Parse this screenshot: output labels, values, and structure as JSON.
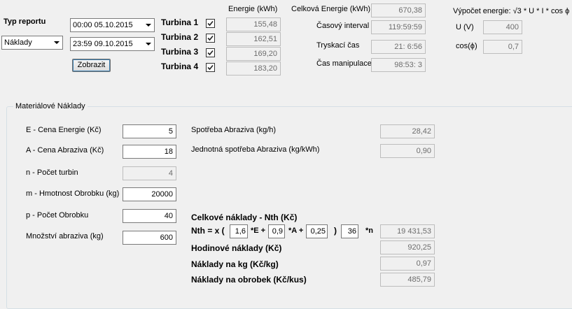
{
  "report": {
    "type_label": "Typ reportu",
    "type_value": "Náklady",
    "date_from": "00:00 05.10.2015",
    "date_to": "23:59 09.10.2015",
    "show_button": "Zobrazit"
  },
  "turbines": {
    "energy_header": "Energie (kWh)",
    "items": [
      {
        "label": "Turbina 1",
        "checked": true,
        "value": "155,48"
      },
      {
        "label": "Turbina 2",
        "checked": true,
        "value": "162,51"
      },
      {
        "label": "Turbina 3",
        "checked": true,
        "value": "169,20"
      },
      {
        "label": "Turbina 4",
        "checked": true,
        "value": "183,20"
      }
    ]
  },
  "summary": {
    "total_energy_label": "Celková Energie (kWh)",
    "total_energy_value": "670,38",
    "time_interval_label": "Časový interval",
    "time_interval_value": "119:59:59",
    "blast_time_label": "Tryskací čas",
    "blast_time_value": "21: 6:56",
    "handling_time_label": "Čas manipulace",
    "handling_time_value": "98:53: 3"
  },
  "energy_calc": {
    "formula_label": "Výpočet energie: √3 * U * I * cos ϕ",
    "u_label": "U (V)",
    "u_value": "400",
    "cos_label": "cos(ϕ)",
    "cos_value": "0,7"
  },
  "material_costs": {
    "group_title": "Materiálové Náklady",
    "inputs": [
      {
        "label": "E - Cena Energie (Kč)",
        "value": "5"
      },
      {
        "label": "A - Cena Abraziva (Kč)",
        "value": "18"
      },
      {
        "label": "n - Počet turbin",
        "value": "4"
      },
      {
        "label": "m - Hmotnost Obrobku (kg)",
        "value": "20000"
      },
      {
        "label": "p - Počet Obrobku",
        "value": "40"
      },
      {
        "label": "Množství abraziva (kg)",
        "value": "600"
      }
    ],
    "abrasive_consumption_label": "Spotřeba Abraziva (kg/h)",
    "abrasive_consumption_value": "28,42",
    "unit_consumption_label": "Jednotná spotřeba Abraziva (kg/kWh)",
    "unit_consumption_value": "0,90",
    "total_costs_label": "Celkové náklady - Nth (Kč)",
    "formula": {
      "prefix": "Nth = x (",
      "coef1": "1,6",
      "e_label": "*E +",
      "coef2": "0,9",
      "a_label": "*A +",
      "coef3": "0,25",
      "close": ")",
      "coef4": "36",
      "n_label": "*n",
      "result": "19 431,53"
    },
    "hourly_costs_label": "Hodinové náklady (Kč)",
    "hourly_costs_value": "920,25",
    "costs_per_kg_label": "Náklady na kg (Kč/kg)",
    "costs_per_kg_value": "0,97",
    "costs_per_piece_label": "Náklady na obrobek (Kč/kus)",
    "costs_per_piece_value": "485,79"
  }
}
